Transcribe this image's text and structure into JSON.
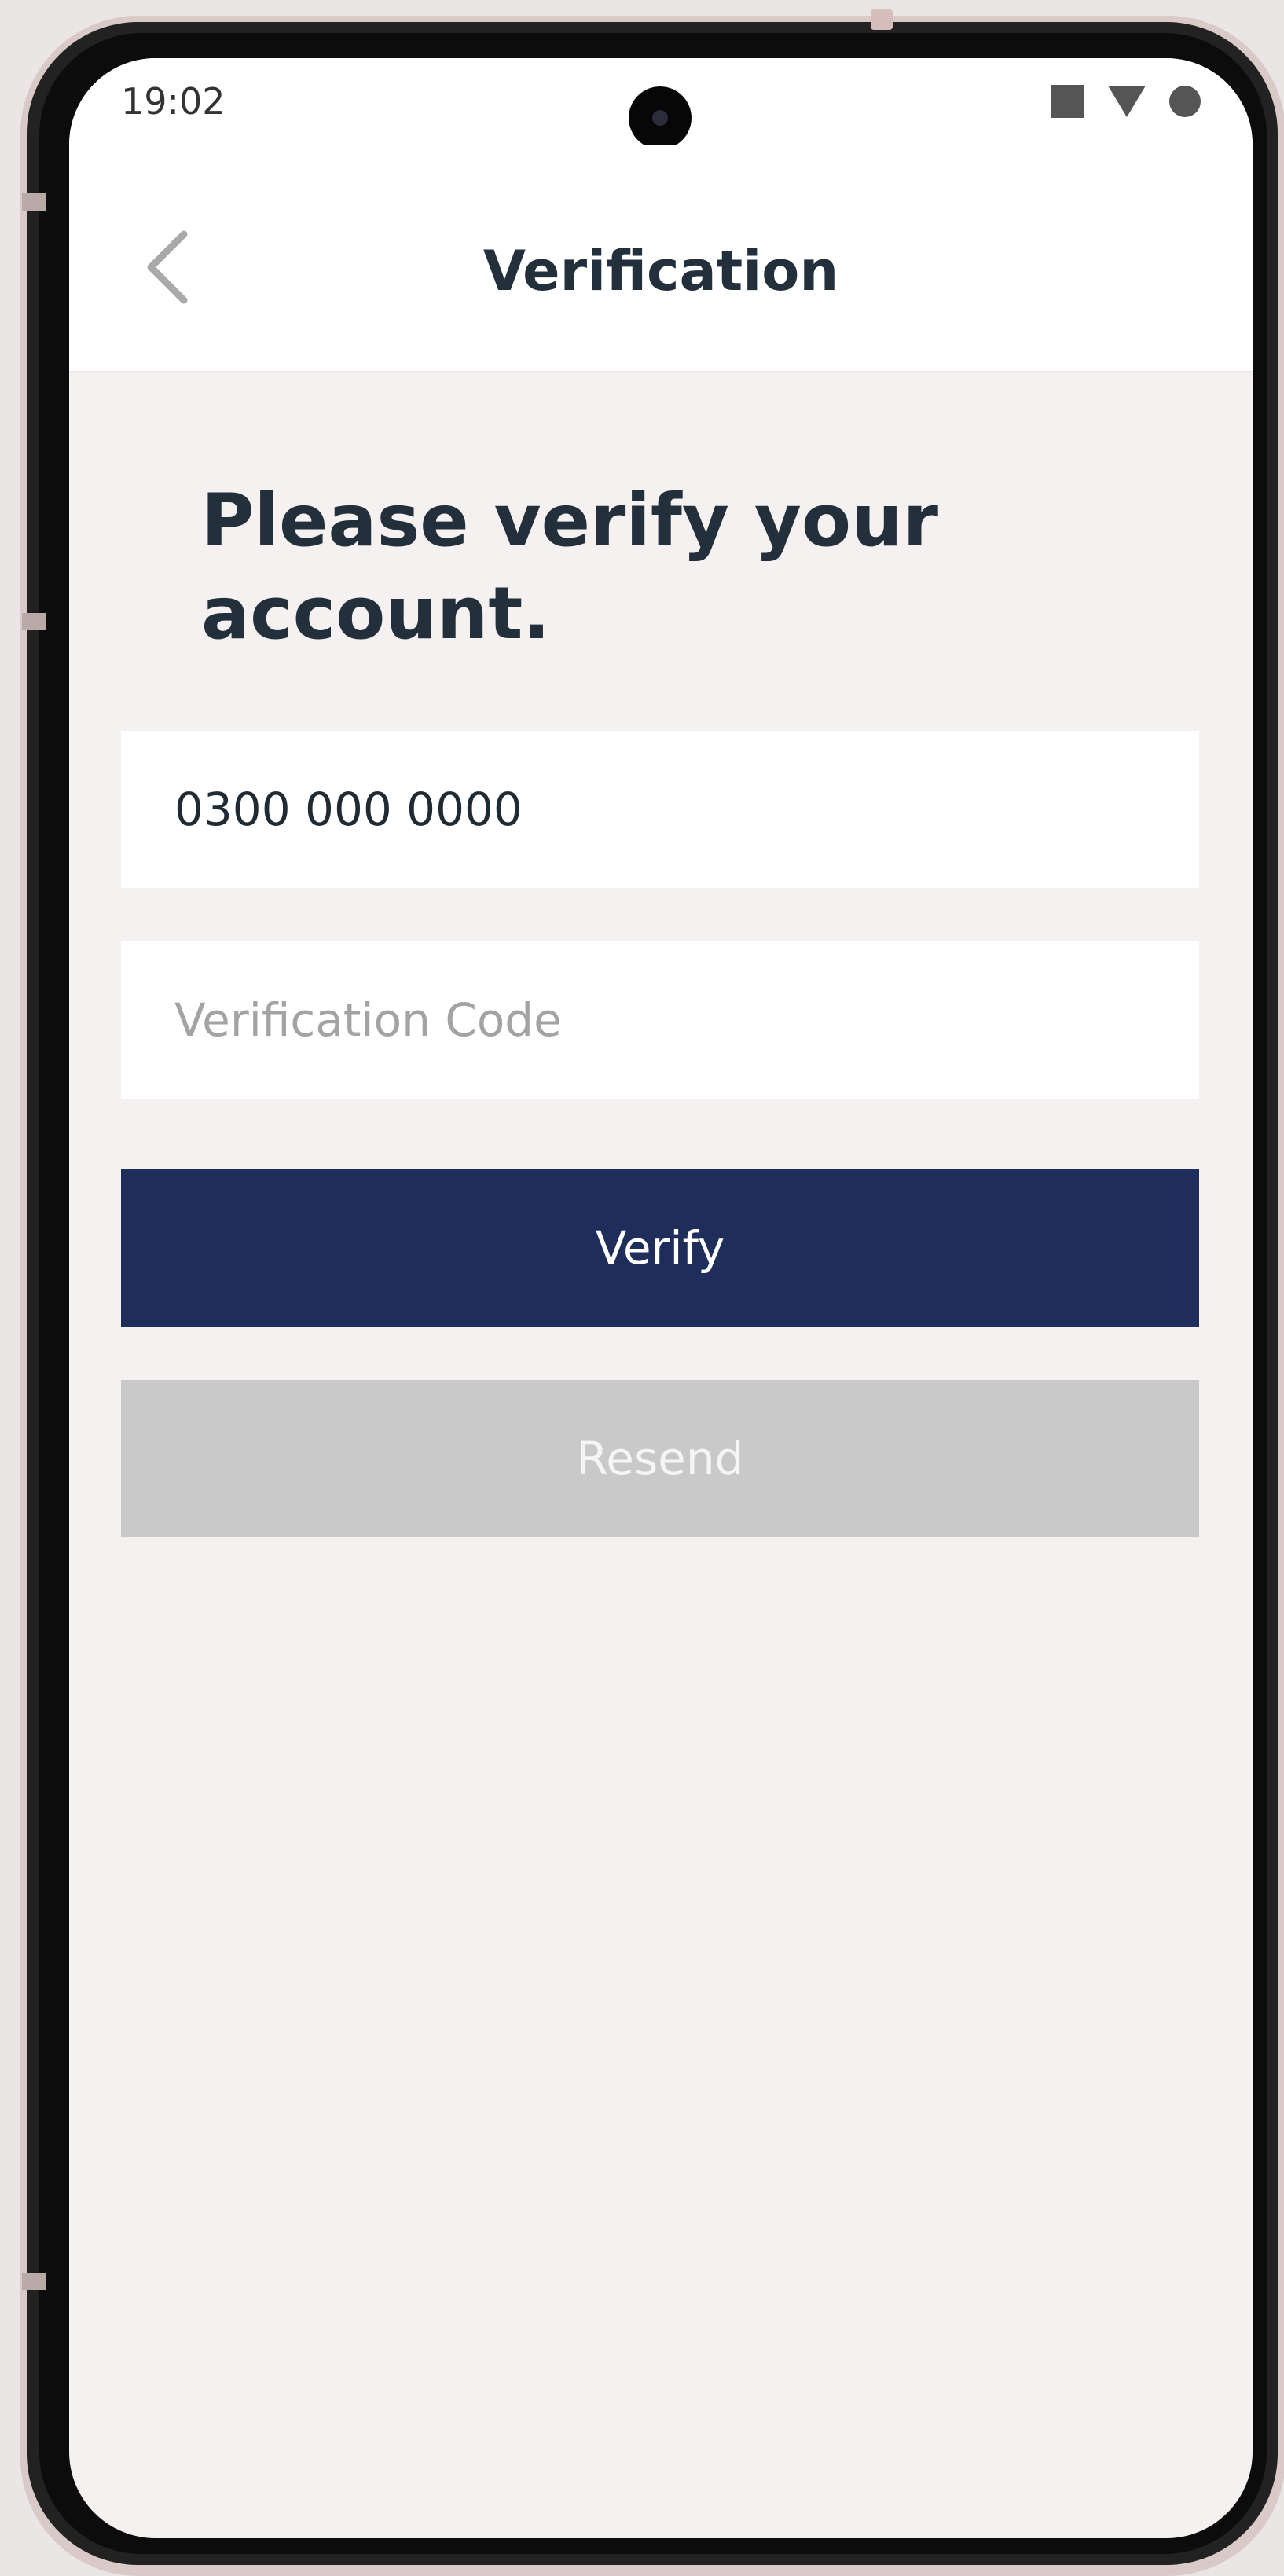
{
  "status_bar": {
    "time": "19:02",
    "icons": [
      "square-icon",
      "wifi-triangle-icon",
      "battery-circle-icon"
    ]
  },
  "app_bar": {
    "title": "Verification",
    "back_icon": "chevron-left-icon"
  },
  "main": {
    "headline": "Please verify your account.",
    "phone_field": {
      "value": "0300 000 0000",
      "placeholder": ""
    },
    "code_field": {
      "value": "",
      "placeholder": "Verification Code"
    },
    "verify_label": "Verify",
    "resend_label": "Resend"
  },
  "colors": {
    "primary": "#1f2d5b",
    "disabled": "#c9c9c9",
    "background": "#f4f1f0",
    "text_dark": "#23303b"
  }
}
